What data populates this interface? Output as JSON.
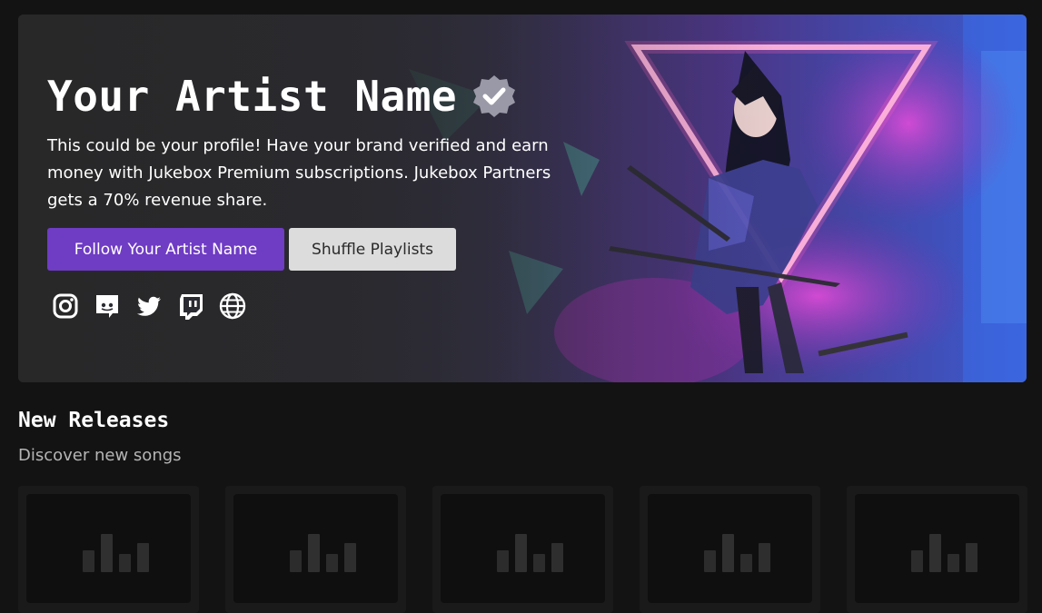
{
  "hero": {
    "artist_name": "Your Artist Name",
    "description": "This could be your profile! Have your brand verified and earn money with Jukebox Premium subscriptions. Jukebox Partners gets a 70% revenue share.",
    "follow_label": "Follow Your Artist Name",
    "shuffle_label": "Shuffle Playlists",
    "social_icons": [
      "instagram-icon",
      "discord-icon",
      "twitter-icon",
      "twitch-icon",
      "globe-icon"
    ]
  },
  "new_releases": {
    "title": "New Releases",
    "subtitle": "Discover new songs",
    "placeholder_count": 5
  },
  "colors": {
    "background": "#131313",
    "accent": "#6f3cc4",
    "secondary_button": "#dcdcdc"
  }
}
